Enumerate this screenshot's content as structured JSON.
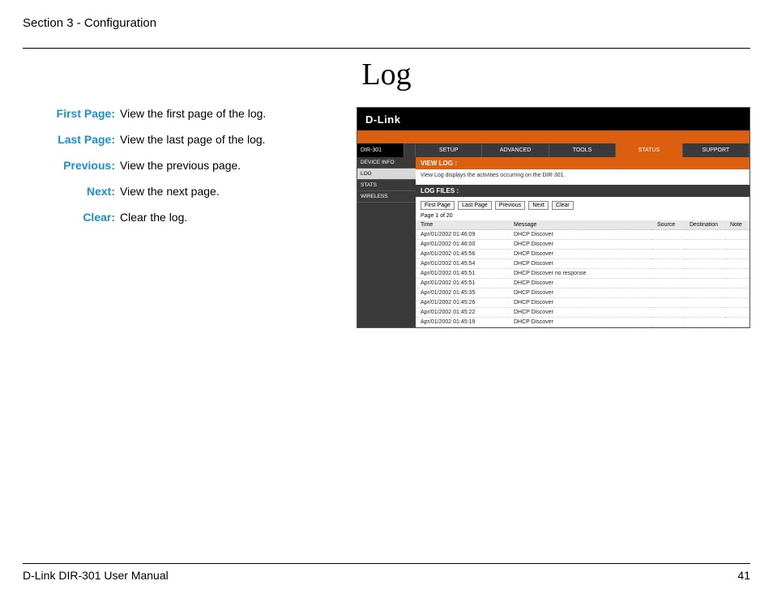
{
  "header": {
    "section": "Section 3 - Configuration"
  },
  "title": "Log",
  "glossary": [
    {
      "term": "First Page:",
      "def": "View the first page of the log."
    },
    {
      "term": "Last Page:",
      "def": "View the last page of the log."
    },
    {
      "term": "Previous:",
      "def": "View the previous page."
    },
    {
      "term": "Next:",
      "def": "View the next page."
    },
    {
      "term": "Clear:",
      "def": "Clear the log."
    }
  ],
  "screenshot": {
    "logo": "D-Link",
    "model": "DIR-301",
    "nav": [
      "SETUP",
      "ADVANCED",
      "TOOLS",
      "STATUS",
      "SUPPORT"
    ],
    "side": [
      "DEVICE INFO",
      "LOG",
      "STATS",
      "WIRELESS"
    ],
    "panel_head": "VIEW LOG :",
    "panel_sub": "View Log displays the activities occurring on the DIR-301.",
    "files_head": "LOG FILES :",
    "buttons": [
      "First Page",
      "Last Page",
      "Previous",
      "Next",
      "Clear"
    ],
    "page_info": "Page 1 of 20",
    "cols": [
      "Time",
      "Message",
      "Source",
      "Destination",
      "Note"
    ],
    "rows": [
      {
        "time": "Apr/01/2002 01:46:09",
        "msg": "DHCP Discover"
      },
      {
        "time": "Apr/01/2002 01:46:00",
        "msg": "DHCP Discover"
      },
      {
        "time": "Apr/01/2002 01:45:56",
        "msg": "DHCP Discover"
      },
      {
        "time": "Apr/01/2002 01:45:54",
        "msg": "DHCP Discover"
      },
      {
        "time": "Apr/01/2002 01:45:51",
        "msg": "DHCP Discover no response"
      },
      {
        "time": "Apr/01/2002 01:45:51",
        "msg": "DHCP Discover"
      },
      {
        "time": "Apr/01/2002 01:45:35",
        "msg": "DHCP Discover"
      },
      {
        "time": "Apr/01/2002 01:45:26",
        "msg": "DHCP Discover"
      },
      {
        "time": "Apr/01/2002 01:45:22",
        "msg": "DHCP Discover"
      },
      {
        "time": "Apr/01/2002 01:45:19",
        "msg": "DHCP Discover"
      }
    ]
  },
  "footer": {
    "left": "D-Link DIR-301 User Manual",
    "right": "41"
  }
}
